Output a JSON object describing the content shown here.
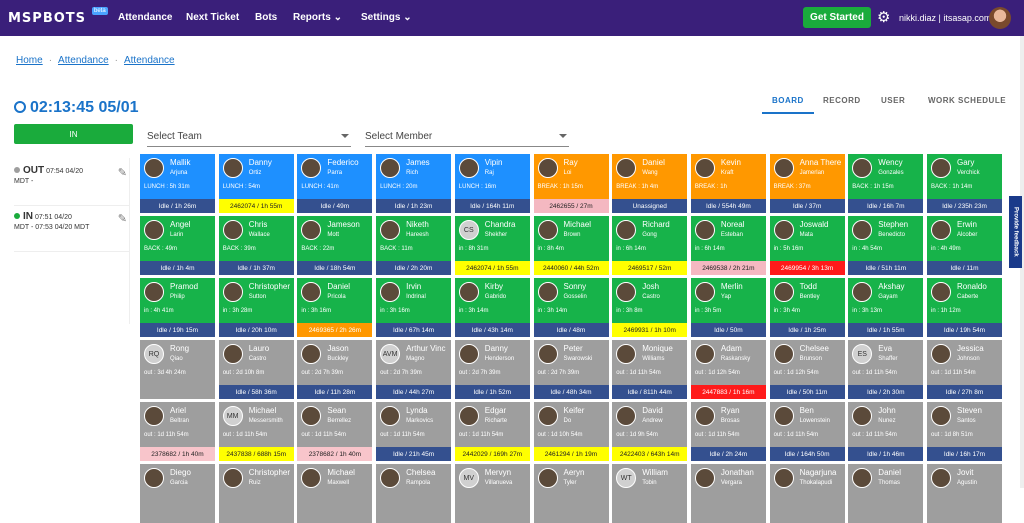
{
  "brand": {
    "logo": "MSPBOTS",
    "badge": "beta"
  },
  "nav": {
    "attendance": "Attendance",
    "next_ticket": "Next Ticket",
    "bots": "Bots",
    "reports": "Reports",
    "settings": "Settings"
  },
  "header": {
    "get_started": "Get Started",
    "user": "nikki.diaz | itsasap.com"
  },
  "breadcrumb": [
    "Home",
    "Attendance",
    "Attendance"
  ],
  "clock": "02:13:45 05/01",
  "tabs": [
    "BOARD",
    "RECORD",
    "USER",
    "WORK SCHEDULE"
  ],
  "in_button": "IN",
  "filters": {
    "team": "Select Team",
    "member": "Select Member"
  },
  "events": [
    {
      "type": "OUT",
      "time": "07:54 04/20",
      "tz": "MDT -"
    },
    {
      "type": "IN",
      "time": "07:51 04/20",
      "tz": "MDT - 07:53 04/20 MDT"
    }
  ],
  "feedback": "Provide feedback",
  "cards": [
    {
      "name": "Mallik",
      "sub": "Arjuna",
      "status": "LUNCH : 5h 31m",
      "ticket": "Idle / 1h 26m",
      "color": "blue",
      "tcolor": "navy"
    },
    {
      "name": "Danny",
      "sub": "Ortiz",
      "status": "LUNCH : 54m",
      "ticket": "2462074 / 1h 55m",
      "color": "blue",
      "tcolor": "yellow"
    },
    {
      "name": "Federico",
      "sub": "Parra",
      "status": "LUNCH : 41m",
      "ticket": "Idle / 49m",
      "color": "blue",
      "tcolor": "navy"
    },
    {
      "name": "James",
      "sub": "Rich",
      "status": "LUNCH : 20m",
      "ticket": "Idle / 1h 23m",
      "color": "blue",
      "tcolor": "navy"
    },
    {
      "name": "Vipin",
      "sub": "Raj",
      "status": "LUNCH : 16m",
      "ticket": "Idle / 164h 11m",
      "color": "blue",
      "tcolor": "navy"
    },
    {
      "name": "Ray",
      "sub": "Loi",
      "status": "BREAK : 1h 15m",
      "ticket": "2462655 / 27m",
      "color": "orange",
      "tcolor": "pink"
    },
    {
      "name": "Daniel",
      "sub": "Wang",
      "status": "BREAK : 1h 4m",
      "ticket": "Unassigned",
      "color": "orange",
      "tcolor": "navy"
    },
    {
      "name": "Kevin",
      "sub": "Kraft",
      "status": "BREAK : 1h",
      "ticket": "Idle / 554h 49m",
      "color": "orange",
      "tcolor": "navy"
    },
    {
      "name": "Anna There",
      "sub": "Jamerlan",
      "status": "BREAK : 37m",
      "ticket": "Idle / 37m",
      "color": "orange",
      "tcolor": "navy"
    },
    {
      "name": "Wency",
      "sub": "Gonzales",
      "status": "BACK : 1h 15m",
      "ticket": "Idle / 16h 7m",
      "color": "green",
      "tcolor": "navy"
    },
    {
      "name": "Gary",
      "sub": "Verchick",
      "status": "BACK : 1h 14m",
      "ticket": "Idle / 235h 23m",
      "color": "green",
      "tcolor": "navy"
    },
    {
      "name": "Angel",
      "sub": "Larin",
      "status": "BACK : 49m",
      "ticket": "Idle / 1h 4m",
      "color": "green",
      "tcolor": "navy"
    },
    {
      "name": "Chris",
      "sub": "Wallace",
      "status": "BACK : 39m",
      "ticket": "Idle / 1h 37m",
      "color": "green",
      "tcolor": "navy"
    },
    {
      "name": "Jameson",
      "sub": "Mott",
      "status": "BACK : 22m",
      "ticket": "Idle / 18h 54m",
      "color": "green",
      "tcolor": "navy"
    },
    {
      "name": "Niketh",
      "sub": "Hareesh",
      "status": "BACK : 11m",
      "ticket": "Idle / 2h 20m",
      "color": "green",
      "tcolor": "navy"
    },
    {
      "name": "Chandra",
      "sub": "Shekher",
      "status": "in : 8h 31m",
      "ticket": "2462074 / 1h 55m",
      "color": "green",
      "tcolor": "yellow",
      "initial": "CS"
    },
    {
      "name": "Michael",
      "sub": "Brown",
      "status": "in : 8h 4m",
      "ticket": "2440060 / 44h 52m",
      "color": "green",
      "tcolor": "yellow"
    },
    {
      "name": "Richard",
      "sub": "Gong",
      "status": "in : 6h 14m",
      "ticket": "2469517 / 52m",
      "color": "green",
      "tcolor": "yellow"
    },
    {
      "name": "Noreal",
      "sub": "Esteban",
      "status": "in : 6h 14m",
      "ticket": "2469538 / 2h 21m",
      "color": "green",
      "tcolor": "pink"
    },
    {
      "name": "Joswald",
      "sub": "Mata",
      "status": "in : 5h 16m",
      "ticket": "2469954 / 3h 13m",
      "color": "green",
      "tcolor": "red"
    },
    {
      "name": "Stephen",
      "sub": "Benedicto",
      "status": "in : 4h 54m",
      "ticket": "Idle / 51h 11m",
      "color": "green",
      "tcolor": "navy"
    },
    {
      "name": "Erwin",
      "sub": "Alcober",
      "status": "in : 4h 49m",
      "ticket": "Idle / 11m",
      "color": "green",
      "tcolor": "navy"
    },
    {
      "name": "Pramod",
      "sub": "Philip",
      "status": "in : 4h 41m",
      "ticket": "Idle / 19h 15m",
      "color": "green",
      "tcolor": "navy"
    },
    {
      "name": "Christopher",
      "sub": "Sutton",
      "status": "in : 3h 28m",
      "ticket": "Idle / 20h 10m",
      "color": "green",
      "tcolor": "navy"
    },
    {
      "name": "Daniel",
      "sub": "Pricola",
      "status": "in : 3h 16m",
      "ticket": "2469365 / 2h 26m",
      "color": "green",
      "tcolor": "orange"
    },
    {
      "name": "Irvin",
      "sub": "Indrinal",
      "status": "in : 3h 16m",
      "ticket": "Idle / 67h 14m",
      "color": "green",
      "tcolor": "navy"
    },
    {
      "name": "Kirby",
      "sub": "Gabrido",
      "status": "in : 3h 14m",
      "ticket": "Idle / 43h 14m",
      "color": "green",
      "tcolor": "navy"
    },
    {
      "name": "Sonny",
      "sub": "Gosselin",
      "status": "in : 3h 14m",
      "ticket": "Idle / 48m",
      "color": "green",
      "tcolor": "navy"
    },
    {
      "name": "Josh",
      "sub": "Castro",
      "status": "in : 3h 8m",
      "ticket": "2469931 / 1h 10m",
      "color": "green",
      "tcolor": "yellow"
    },
    {
      "name": "Merlin",
      "sub": "Yap",
      "status": "in : 3h 5m",
      "ticket": "Idle / 50m",
      "color": "green",
      "tcolor": "navy"
    },
    {
      "name": "Todd",
      "sub": "Bentley",
      "status": "in : 3h 4m",
      "ticket": "Idle / 1h 25m",
      "color": "green",
      "tcolor": "navy"
    },
    {
      "name": "Akshay",
      "sub": "Gayam",
      "status": "in : 3h 13m",
      "ticket": "Idle / 1h 55m",
      "color": "green",
      "tcolor": "navy"
    },
    {
      "name": "Ronaldo",
      "sub": "Caberte",
      "status": "in : 1h 12m",
      "ticket": "Idle / 19h 54m",
      "color": "green",
      "tcolor": "navy"
    },
    {
      "name": "Rong",
      "sub": "Qiao",
      "status": "out : 3d 4h 24m",
      "ticket": "",
      "color": "gray",
      "tcolor": "none",
      "initial": "RQ"
    },
    {
      "name": "Lauro",
      "sub": "Castro",
      "status": "out : 2d 10h 8m",
      "ticket": "Idle / 58h 36m",
      "color": "gray",
      "tcolor": "navy"
    },
    {
      "name": "Jason",
      "sub": "Buckley",
      "status": "out : 2d 7h 39m",
      "ticket": "Idle / 11h 28m",
      "color": "gray",
      "tcolor": "navy"
    },
    {
      "name": "Arthur Vinc",
      "sub": "Magno",
      "status": "out : 2d 7h 39m",
      "ticket": "Idle / 44h 27m",
      "color": "gray",
      "tcolor": "navy",
      "initial": "AVM"
    },
    {
      "name": "Danny",
      "sub": "Henderson",
      "status": "out : 2d 7h 39m",
      "ticket": "Idle / 1h 52m",
      "color": "gray",
      "tcolor": "navy"
    },
    {
      "name": "Peter",
      "sub": "Swarowski",
      "status": "out : 2d 7h 39m",
      "ticket": "Idle / 48h 34m",
      "color": "gray",
      "tcolor": "navy"
    },
    {
      "name": "Monique",
      "sub": "Williams",
      "status": "out : 1d 11h 54m",
      "ticket": "Idle / 811h 44m",
      "color": "gray",
      "tcolor": "navy"
    },
    {
      "name": "Adam",
      "sub": "Raskansky",
      "status": "out : 1d 12h 54m",
      "ticket": "2447883 / 1h 16m",
      "color": "gray",
      "tcolor": "red"
    },
    {
      "name": "Chelsee",
      "sub": "Brunson",
      "status": "out : 1d 12h 54m",
      "ticket": "Idle / 50h 11m",
      "color": "gray",
      "tcolor": "navy"
    },
    {
      "name": "Eva",
      "sub": "Shaffer",
      "status": "out : 1d 11h 54m",
      "ticket": "Idle / 2h 30m",
      "color": "gray",
      "tcolor": "navy",
      "initial": "ES"
    },
    {
      "name": "Jessica",
      "sub": "Johnson",
      "status": "out : 1d 11h 54m",
      "ticket": "Idle / 27h 8m",
      "color": "gray",
      "tcolor": "navy"
    },
    {
      "name": "Ariel",
      "sub": "Beltran",
      "status": "out : 1d 11h 54m",
      "ticket": "2378682 / 1h 40m",
      "color": "gray",
      "tcolor": "lpink"
    },
    {
      "name": "Michael",
      "sub": "Messersmith",
      "status": "out : 1d 11h 54m",
      "ticket": "2437838 / 688h 15m",
      "color": "gray",
      "tcolor": "yellow",
      "initial": "MM"
    },
    {
      "name": "Sean",
      "sub": "Berrellez",
      "status": "out : 1d 11h 54m",
      "ticket": "2378682 / 1h 40m",
      "color": "gray",
      "tcolor": "lpink"
    },
    {
      "name": "Lynda",
      "sub": "Markovics",
      "status": "out : 1d 11h 54m",
      "ticket": "Idle / 21h 45m",
      "color": "gray",
      "tcolor": "navy"
    },
    {
      "name": "Edgar",
      "sub": "Richarte",
      "status": "out : 1d 11h 54m",
      "ticket": "2442029 / 169h 27m",
      "color": "gray",
      "tcolor": "yellow"
    },
    {
      "name": "Keifer",
      "sub": "Do",
      "status": "out : 1d 10h 54m",
      "ticket": "2461294 / 1h 19m",
      "color": "gray",
      "tcolor": "yellow"
    },
    {
      "name": "David",
      "sub": "Andrew",
      "status": "out : 1d 9h 54m",
      "ticket": "2422403 / 643h 14m",
      "color": "gray",
      "tcolor": "yellow"
    },
    {
      "name": "Ryan",
      "sub": "Brosas",
      "status": "out : 1d 11h 54m",
      "ticket": "Idle / 2h 24m",
      "color": "gray",
      "tcolor": "navy"
    },
    {
      "name": "Ben",
      "sub": "Lowenstein",
      "status": "out : 1d 11h 54m",
      "ticket": "Idle / 164h 50m",
      "color": "gray",
      "tcolor": "navy"
    },
    {
      "name": "John",
      "sub": "Nunez",
      "status": "out : 1d 11h 54m",
      "ticket": "Idle / 1h 46m",
      "color": "gray",
      "tcolor": "navy"
    },
    {
      "name": "Steven",
      "sub": "Santos",
      "status": "out : 1d 8h 51m",
      "ticket": "Idle / 16h 17m",
      "color": "gray",
      "tcolor": "navy"
    },
    {
      "name": "Diego",
      "sub": "Garcia",
      "status": "",
      "ticket": "",
      "color": "gray",
      "tcolor": "none"
    },
    {
      "name": "Christopher",
      "sub": "Ruiz",
      "status": "",
      "ticket": "",
      "color": "gray",
      "tcolor": "none"
    },
    {
      "name": "Michael",
      "sub": "Maxwell",
      "status": "",
      "ticket": "",
      "color": "gray",
      "tcolor": "none"
    },
    {
      "name": "Chelsea",
      "sub": "Rampola",
      "status": "",
      "ticket": "",
      "color": "gray",
      "tcolor": "none"
    },
    {
      "name": "Mervyn",
      "sub": "Villanueva",
      "status": "",
      "ticket": "",
      "color": "gray",
      "tcolor": "none",
      "initial": "MV"
    },
    {
      "name": "Aeryn",
      "sub": "Tyler",
      "status": "",
      "ticket": "",
      "color": "gray",
      "tcolor": "none"
    },
    {
      "name": "William",
      "sub": "Tobin",
      "status": "",
      "ticket": "",
      "color": "gray",
      "tcolor": "none",
      "initial": "WT"
    },
    {
      "name": "Jonathan",
      "sub": "Vergara",
      "status": "",
      "ticket": "",
      "color": "gray",
      "tcolor": "none"
    },
    {
      "name": "Nagarjuna",
      "sub": "Thokalapudi",
      "status": "",
      "ticket": "",
      "color": "gray",
      "tcolor": "none"
    },
    {
      "name": "Daniel",
      "sub": "Thomas",
      "status": "",
      "ticket": "",
      "color": "gray",
      "tcolor": "none"
    },
    {
      "name": "Jovit",
      "sub": "Agustin",
      "status": "",
      "ticket": "",
      "color": "gray",
      "tcolor": "none"
    }
  ]
}
